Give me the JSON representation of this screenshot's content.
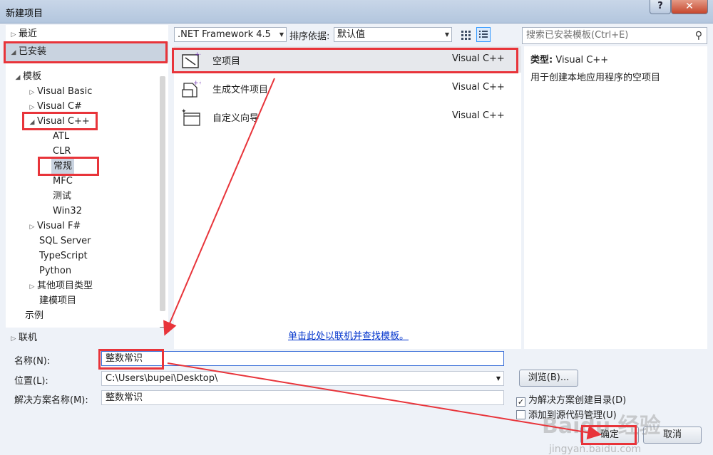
{
  "window": {
    "title": "新建项目",
    "help": "?",
    "close": "✕"
  },
  "tree": {
    "recent": "最近",
    "installed": "已安装",
    "templates": "模板",
    "items": [
      {
        "label": "Visual Basic"
      },
      {
        "label": "Visual C#"
      },
      {
        "label": "Visual C++"
      },
      {
        "label": "ATL"
      },
      {
        "label": "CLR"
      },
      {
        "label": "常规"
      },
      {
        "label": "MFC"
      },
      {
        "label": "测试"
      },
      {
        "label": "Win32"
      },
      {
        "label": "Visual F#"
      },
      {
        "label": "SQL Server"
      },
      {
        "label": "TypeScript"
      },
      {
        "label": "Python"
      },
      {
        "label": "其他项目类型"
      },
      {
        "label": "建模项目"
      }
    ],
    "samples": "示例",
    "online": "联机"
  },
  "toolbar": {
    "framework": ".NET Framework 4.5",
    "sort_label": "排序依据:",
    "sort_value": "默认值",
    "search_placeholder": "搜索已安装模板(Ctrl+E)"
  },
  "templates": [
    {
      "name": "空项目",
      "lang": "Visual C++",
      "icon": "empty-project-icon"
    },
    {
      "name": "生成文件项目",
      "lang": "Visual C++",
      "icon": "makefile-project-icon"
    },
    {
      "name": "自定义向导",
      "lang": "Visual C++",
      "icon": "custom-wizard-icon"
    }
  ],
  "online_link": "单击此处以联机并查找模板。",
  "details": {
    "type_label": "类型:",
    "type_value": "Visual C++",
    "description": "用于创建本地应用程序的空项目"
  },
  "form": {
    "name_label": "名称(N):",
    "name_value": "整数常识",
    "location_label": "位置(L):",
    "location_value": "C:\\Users\\bupei\\Desktop\\",
    "solution_label": "解决方案名称(M):",
    "solution_value": "整数常识",
    "browse": "浏览(B)...",
    "create_dir": "为解决方案创建目录(D)",
    "add_source": "添加到源代码管理(U)",
    "ok": "确定",
    "cancel": "取消"
  },
  "watermark": "Baidu 经验",
  "watermark_url": "jingyan.baidu.com",
  "colors": {
    "annotation": "#e8343a",
    "link": "#0033cc",
    "selected": "#c9d3e0"
  }
}
